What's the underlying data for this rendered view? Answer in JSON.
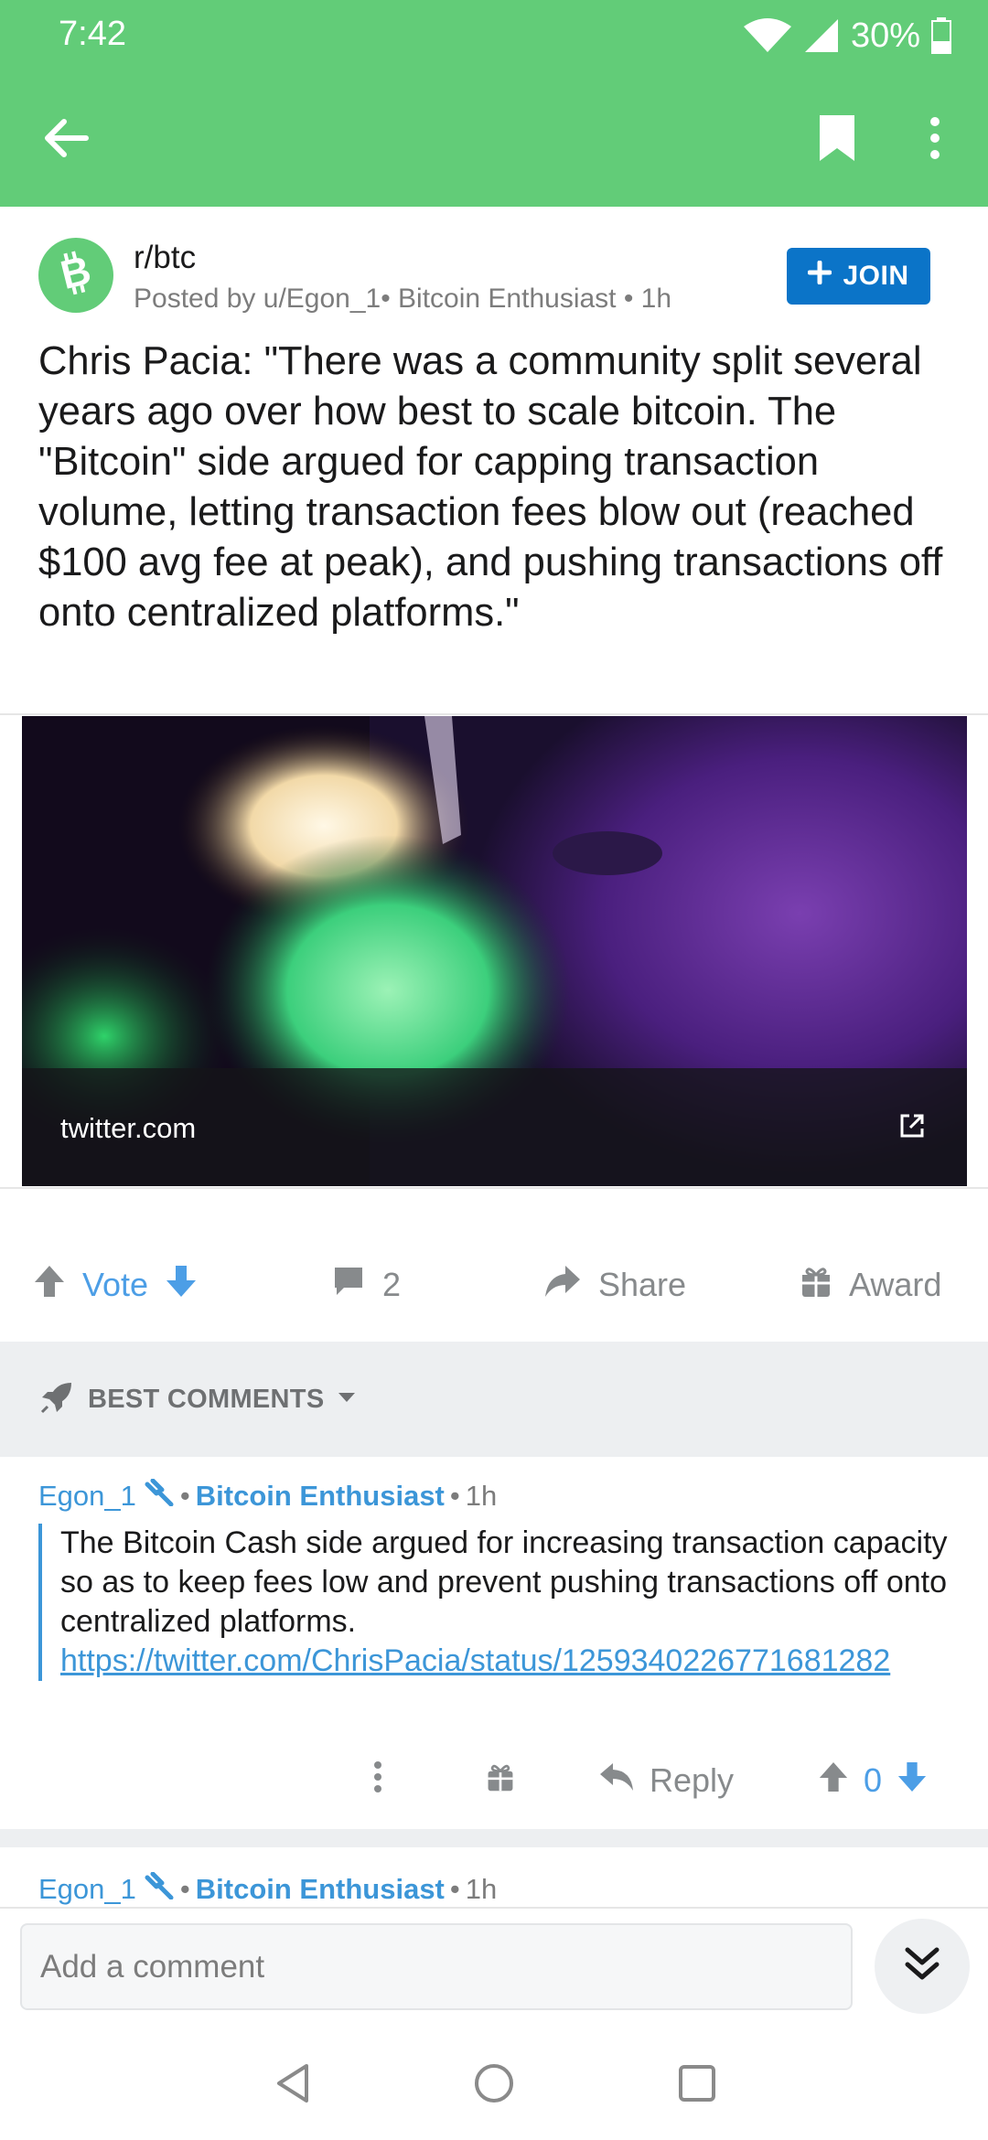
{
  "status_bar": {
    "time": "7:42",
    "battery": "30%"
  },
  "colors": {
    "brand": "#62cc78",
    "accent": "#0b74c8",
    "link": "#3c96d8",
    "vote": "#4c9ee6"
  },
  "app_bar": {
    "icons": [
      "back-arrow-icon",
      "bookmark-icon",
      "more-vertical-icon"
    ]
  },
  "post": {
    "subreddit": "r/btc",
    "meta": "Posted by u/Egon_1• Bitcoin Enthusiast • 1h",
    "join_label": "JOIN",
    "title": "Chris Pacia: \"There was a community split several years ago over how best to scale bitcoin. The \"Bitcoin\" side argued for capping transaction volume, letting transaction fees blow out (reached $100 avg fee at peak), and pushing transactions off onto centralized platforms.\"",
    "link_domain": "twitter.com",
    "vote_label": "Vote",
    "comment_count": "2",
    "share_label": "Share",
    "award_label": "Award"
  },
  "comments_header": {
    "label": "BEST COMMENTS"
  },
  "comments": [
    {
      "user": "Egon_1",
      "flair": "Bitcoin Enthusiast",
      "time": "1h",
      "body_text": "The Bitcoin Cash side argued for increasing transaction capacity so as to keep fees low and prevent pushing transactions off onto centralized platforms.",
      "link": "https://twitter.com/ChrisPacia/status/1259340226771681282",
      "reply_label": "Reply",
      "score": "0"
    },
    {
      "user": "Egon_1",
      "flair": "Bitcoin Enthusiast",
      "time": "1h"
    }
  ],
  "composer": {
    "placeholder": "Add a comment"
  }
}
